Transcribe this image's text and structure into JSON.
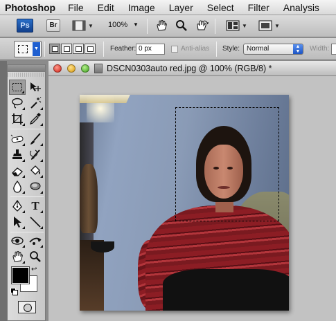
{
  "menubar": {
    "app_name": "Photoshop",
    "items": [
      "File",
      "Edit",
      "Image",
      "Layer",
      "Select",
      "Filter",
      "Analysis"
    ]
  },
  "appbar": {
    "ps_badge": "Ps",
    "br_badge": "Br",
    "zoom": "100%"
  },
  "options": {
    "feather_label": "Feather:",
    "feather_value": "0 px",
    "antialias_label": "Anti-alias",
    "style_label": "Style:",
    "style_value": "Normal",
    "width_label": "Width:"
  },
  "toolbox": {
    "tools": [
      "rectangular-marquee",
      "move",
      "lasso",
      "magic-wand",
      "crop",
      "eyedropper",
      "spot-healing",
      "brush",
      "clone-stamp",
      "history-brush",
      "eraser",
      "paint-bucket",
      "blur",
      "dodge",
      "pen",
      "type",
      "path-selection",
      "line",
      "3d-rotate",
      "3d-orbit",
      "hand",
      "zoom"
    ],
    "foreground_color": "#000000",
    "background_color": "#ffffff"
  },
  "document": {
    "title": "DSCN0303auto red.jpg @ 100% (RGB/8) *"
  },
  "colors": {
    "accent_blue": "#1f5fd0",
    "close_red": "#d21e12",
    "minimize_yellow": "#d89a0c",
    "zoom_green": "#3a9e1c"
  }
}
